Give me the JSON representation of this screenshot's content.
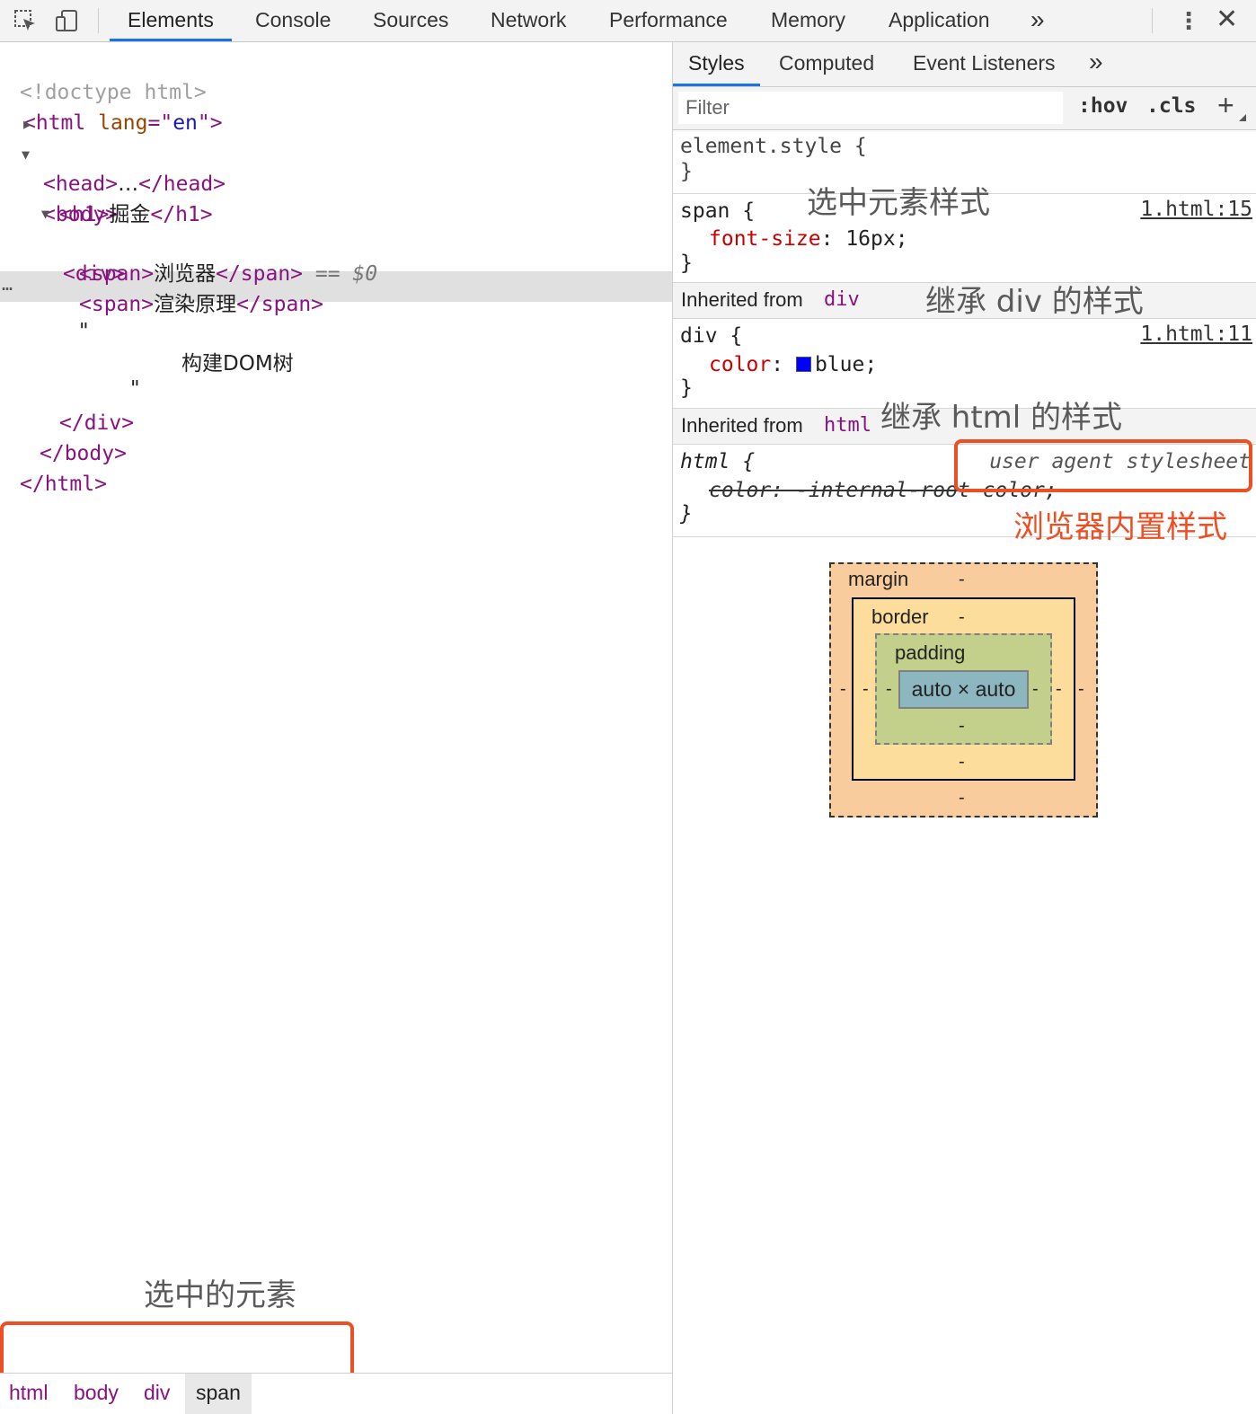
{
  "toolbar": {
    "tabs": [
      "Elements",
      "Console",
      "Sources",
      "Network",
      "Performance",
      "Memory",
      "Application"
    ],
    "active_tab": "Elements",
    "more": "»",
    "kebab": "⋮",
    "close": "✕"
  },
  "dom": {
    "doctype": "<!doctype html>",
    "html_open_tag": "<html",
    "html_attr_name": "lang",
    "html_attr_eq": "=\"",
    "html_attr_value": "en",
    "html_attr_close": "\">",
    "head_open": "<head>",
    "head_ellipsis": "…",
    "head_close": "</head>",
    "body_open": "<body>",
    "h1_open": "<h1>",
    "h1_text": "掘金",
    "h1_close": "</h1>",
    "div_open": "<div>",
    "span1_open": "<span>",
    "span1_text": "浏览器",
    "span1_close": "</span>",
    "selected_marker": " == ",
    "selected_var": "$0",
    "span2_open": "<span>",
    "span2_text": "渲染原理",
    "span2_close": "</span>",
    "quote_open": "\"",
    "text_node": "构建DOM树",
    "quote_close": "\"",
    "div_close": "</div>",
    "body_close": "</body>",
    "html_close": "</html>",
    "dots": "…"
  },
  "breadcrumb": [
    "html",
    "body",
    "div",
    "span"
  ],
  "styles": {
    "tabs": [
      "Styles",
      "Computed",
      "Event Listeners"
    ],
    "more": "»",
    "filter_placeholder": "Filter",
    "hov": ":hov",
    "cls": ".cls",
    "plus": "+",
    "element_style_open": "element.style {",
    "close_brace": "}",
    "span_selector": "span {",
    "span_prop": "font-size",
    "span_value": ": 16px;",
    "span_source": "1.html:15",
    "inherited_label": "Inherited from",
    "inherited_div": "div",
    "div_selector": "div {",
    "div_prop": "color",
    "div_colon": ": ",
    "div_value": "blue;",
    "div_source": "1.html:11",
    "inherited_html": "html",
    "html_selector": "html {",
    "html_decl": "color: -internal-root-color;",
    "html_source": "user agent stylesheet"
  },
  "box_model": {
    "margin_label": "margin",
    "border_label": "border",
    "padding_label": "padding",
    "content": "auto × auto",
    "dash": "-"
  },
  "annotations": {
    "selected_style": "选中元素样式",
    "inherit_div": "继承 div 的样式",
    "inherit_html": "继承 html 的样式",
    "ua_style": "浏览器内置样式",
    "selected_element": "选中的元素"
  },
  "colors": {
    "accent": "#1a73e8",
    "annotation_red": "#ec4f24",
    "tag": "#881280",
    "property": "#c80000",
    "swatch_blue": "#0000ff"
  }
}
